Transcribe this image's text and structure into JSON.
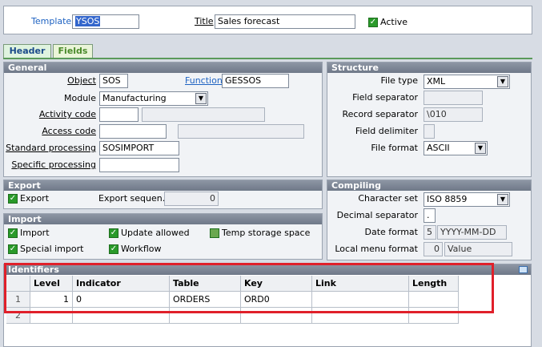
{
  "top": {
    "template_label": "Template",
    "template_value": "YSOS",
    "title_label": "Title",
    "title_value": "Sales forecast",
    "active_label": "Active"
  },
  "tabs": [
    "Header",
    "Fields"
  ],
  "general": {
    "heading": "General",
    "object_label": "Object",
    "object_value": "SOS",
    "function_label": "Function",
    "function_value": "GESSOS",
    "module_label": "Module",
    "module_value": "Manufacturing",
    "activity_label": "Activity code",
    "access_label": "Access code",
    "standard_label": "Standard processing",
    "standard_value": "SOSIMPORT",
    "specific_label": "Specific processing"
  },
  "structure": {
    "heading": "Structure",
    "file_type_label": "File type",
    "file_type_value": "XML",
    "field_sep_label": "Field separator",
    "record_sep_label": "Record separator",
    "record_sep_value": "\\010",
    "field_delim_label": "Field delimiter",
    "file_format_label": "File format",
    "file_format_value": "ASCII"
  },
  "export": {
    "heading": "Export",
    "export_label": "Export",
    "sequence_label": "Export sequen...",
    "sequence_value": "0"
  },
  "compiling": {
    "heading": "Compiling",
    "charset_label": "Character set",
    "charset_value": "ISO 8859",
    "decimal_label": "Decimal separator",
    "decimal_value": ".",
    "date_label": "Date format",
    "date_num": "5",
    "date_value": "YYYY-MM-DD",
    "localmenu_label": "Local menu format",
    "localmenu_num": "0",
    "localmenu_value": "Value"
  },
  "import": {
    "heading": "Import",
    "import_label": "Import",
    "update_label": "Update allowed",
    "temp_label": "Temp storage space",
    "special_label": "Special import",
    "workflow_label": "Workflow"
  },
  "identifiers": {
    "heading": "Identifiers",
    "columns": [
      "Level",
      "Indicator",
      "Table",
      "Key",
      "Link",
      "Length"
    ],
    "rows": [
      {
        "num": "1",
        "level": "1",
        "indicator": "0",
        "table": "ORDERS",
        "key": "ORD0",
        "link": "",
        "length": ""
      },
      {
        "num": "2",
        "level": "",
        "indicator": "",
        "table": "",
        "key": "",
        "link": "",
        "length": ""
      }
    ]
  },
  "colors": {
    "accent_link": "#1f63c2",
    "highlight_box": "#e0202a",
    "check_green": "#2a9a2a"
  }
}
